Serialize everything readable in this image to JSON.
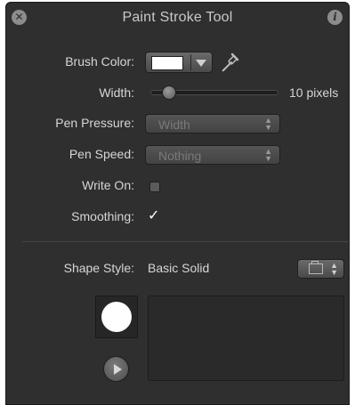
{
  "window": {
    "title": "Paint Stroke Tool",
    "close_icon": "close-icon",
    "info_icon": "info-icon",
    "close_glyph": "✕",
    "info_glyph": "i"
  },
  "brush_color": {
    "label": "Brush Color:",
    "value": "#ffffff",
    "eyedropper_icon": "eyedropper-icon"
  },
  "width": {
    "label": "Width:",
    "value_text": "10 pixels",
    "slider_fraction": 0.1
  },
  "pen_pressure": {
    "label": "Pen Pressure:",
    "value": "Width"
  },
  "pen_speed": {
    "label": "Pen Speed:",
    "value": "Nothing"
  },
  "write_on": {
    "label": "Write On:",
    "checked": false
  },
  "smoothing": {
    "label": "Smoothing:",
    "checked": true,
    "check_glyph": "✓"
  },
  "shape_style": {
    "label": "Shape Style:",
    "value": "Basic Solid",
    "icon": "folder-icon"
  },
  "preview": {
    "play_icon": "play-icon"
  }
}
